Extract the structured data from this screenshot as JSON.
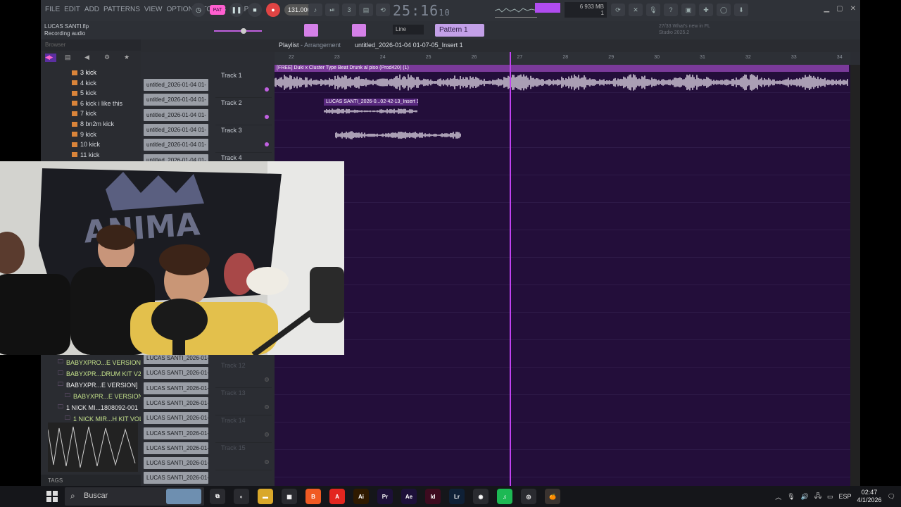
{
  "menu": [
    "FILE",
    "EDIT",
    "ADD",
    "PATTERNS",
    "VIEW",
    "OPTIONS",
    "TOOLS",
    "HELP"
  ],
  "transport": {
    "pat_label": "PAT",
    "tempo": "131.000",
    "time_main": "25:16",
    "time_sub": "10"
  },
  "memory": {
    "line1": "6   933 MB",
    "line2": "1"
  },
  "project": {
    "name": "LUCAS SANTI.flp",
    "status": "Recording audio"
  },
  "toolbar2": {
    "line_mode": "Line",
    "pattern": "Pattern 1",
    "news_line1": "What's new in FL",
    "news_line2": "Studio 2025.2",
    "news_count": "27/33"
  },
  "browser": {
    "header": "Browser",
    "items": [
      {
        "label": "3 kick",
        "kind": "folder",
        "selected": true
      },
      {
        "label": "4 kick",
        "kind": "folder"
      },
      {
        "label": "5 kick",
        "kind": "folder"
      },
      {
        "label": "6 kick i like this",
        "kind": "folder"
      },
      {
        "label": "7 kick",
        "kind": "folder"
      },
      {
        "label": "8 bn2m kick",
        "kind": "folder"
      },
      {
        "label": "9 kick",
        "kind": "folder"
      },
      {
        "label": "10 kick",
        "kind": "folder"
      },
      {
        "label": "11 kick",
        "kind": "folder"
      }
    ],
    "items_bottom": [
      {
        "label": "BABYXPRO...E VERSION]",
        "style": "b"
      },
      {
        "label": "BABYXPR...DRUM KIT V2",
        "style": "b"
      },
      {
        "label": "BABYXPR...E VERSION]",
        "style": "b3"
      },
      {
        "label": "BABYXPR...E VERSION]",
        "style": "b2"
      },
      {
        "label": "1 NICK MI...1808092-001",
        "style": "b3"
      },
      {
        "label": "1 NICK MIR...H KIT VOL 1",
        "style": "b2"
      }
    ],
    "tags_label": "TAGS"
  },
  "playlist": {
    "title_prefix": "Playlist",
    "title_mode": "Arrangement",
    "file": "untitled_2026-01-04 01-07-05_Insert 1",
    "clips_top": [
      "untitled_2026-01-04 01-",
      "untitled_2026-01-04 01-",
      "untitled_2026-01-04 01-",
      "untitled_2026-01-04 01-",
      "untitled_2026-01-04 01-",
      "untitled_2026-01-04 01-"
    ],
    "clips_bottom": [
      "LUCAS SANTI_2026-01-04...",
      "LUCAS SANTI_2026-01-04...",
      "LUCAS SANTI_2026-01-04...",
      "LUCAS SANTI_2026-01-04...",
      "LUCAS SANTI_2026-01-04...",
      "LUCAS SANTI_2026-01-04...",
      "LUCAS SANTI_2026-01-04...",
      "LUCAS SANTI_2026-01-04...",
      "LUCAS SANTI_2026-01-04..."
    ],
    "tracks": [
      "Track 1",
      "Track 2",
      "Track 3",
      "Track 4"
    ],
    "tracks_dim": [
      "Track 12",
      "Track 13",
      "Track 14",
      "Track 15"
    ],
    "ruler": [
      "22",
      "23",
      "24",
      "25",
      "26",
      "27",
      "28",
      "29",
      "30",
      "31",
      "32",
      "33",
      "34"
    ],
    "audio_clip_1": "[FREE] Duki x Cluster Type Beat  Drunk al piso  (Prod420) (1)",
    "audio_clip_2": "LUCAS SANTI_2026-0...02-42-13_Insert 1"
  },
  "taskbar": {
    "search_placeholder": "Buscar",
    "apps": [
      {
        "name": "task-view",
        "label": "⧉",
        "color": "#2a2b30"
      },
      {
        "name": "copilot",
        "label": "◐",
        "color": "#2a2b30"
      },
      {
        "name": "file-explorer",
        "label": "▬",
        "color": "#d9a82a"
      },
      {
        "name": "store",
        "label": "▦",
        "color": "#2a2b30"
      },
      {
        "name": "brave",
        "label": "B",
        "color": "#f05a23"
      },
      {
        "name": "acrobat",
        "label": "A",
        "color": "#e3261f"
      },
      {
        "name": "illustrator",
        "label": "Ai",
        "color": "#2f1a00"
      },
      {
        "name": "premiere",
        "label": "Pr",
        "color": "#1d1039"
      },
      {
        "name": "after-effects",
        "label": "Ae",
        "color": "#1d1039"
      },
      {
        "name": "indesign",
        "label": "Id",
        "color": "#3d0b1f"
      },
      {
        "name": "lightroom",
        "label": "Lr",
        "color": "#0f2036"
      },
      {
        "name": "chrome",
        "label": "◉",
        "color": "#2a2b30"
      },
      {
        "name": "spotify",
        "label": "♫",
        "color": "#1db954"
      },
      {
        "name": "obs",
        "label": "◎",
        "color": "#2a2b30"
      },
      {
        "name": "fl-studio",
        "label": "🍊",
        "color": "#3a3330"
      }
    ],
    "lang": "ESP",
    "time": "02:47",
    "date": "4/1/2026"
  },
  "colors": {
    "accent": "#c042f0",
    "arrangement_bg": "#230e3a",
    "waveform": "#e4dde9"
  }
}
